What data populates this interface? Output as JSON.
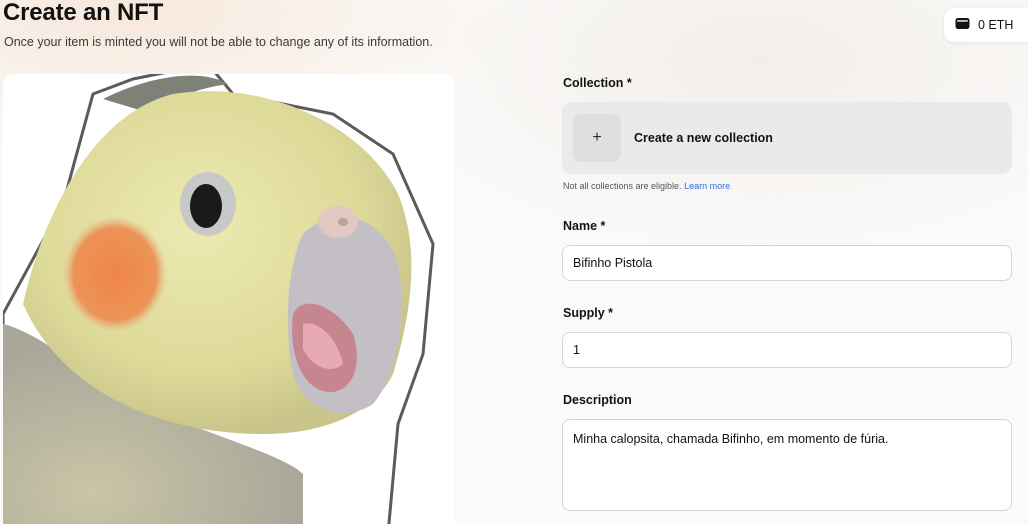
{
  "header": {
    "title": "Create an NFT",
    "subtitle": "Once your item is minted you will not be able to change any of its information."
  },
  "wallet": {
    "balance": "0 ETH",
    "icon": "wallet-icon"
  },
  "media": {
    "description": "cockatiel sticker image"
  },
  "form": {
    "collection": {
      "label": "Collection *",
      "create_label": "Create a new collection",
      "plus_icon": "+",
      "hint_text": "Not all collections are eligible.",
      "learn_more": "Learn more"
    },
    "name": {
      "label": "Name *",
      "value": "Bifinho Pistola"
    },
    "supply": {
      "label": "Supply *",
      "value": "1"
    },
    "description": {
      "label": "Description",
      "value": "Minha calopsita, chamada Bifinho, em momento de fúria."
    }
  },
  "colors": {
    "accent_link": "#2f6fd6",
    "bird_yellow": "#e8e6a2",
    "bird_cheek": "#ec8a4c"
  }
}
